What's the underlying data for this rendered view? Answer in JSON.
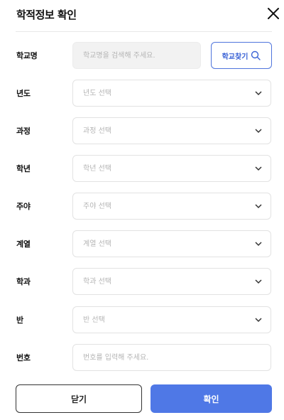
{
  "header": {
    "title": "학적정보 확인"
  },
  "school": {
    "label": "학교명",
    "placeholder": "학교명을 검색해 주세요.",
    "search_label": "학교찾기"
  },
  "fields": [
    {
      "label": "년도",
      "placeholder": "년도 선택"
    },
    {
      "label": "과정",
      "placeholder": "과정 선택"
    },
    {
      "label": "학년",
      "placeholder": "학년 선택"
    },
    {
      "label": "주야",
      "placeholder": "주야 선택"
    },
    {
      "label": "계열",
      "placeholder": "계열 선택"
    },
    {
      "label": "학과",
      "placeholder": "학과 선택"
    },
    {
      "label": "반",
      "placeholder": "반 선택"
    }
  ],
  "number": {
    "label": "번호",
    "placeholder": "번호를 입력해 주세요."
  },
  "footer": {
    "close_label": "닫기",
    "confirm_label": "확인"
  },
  "colors": {
    "accent": "#4f78e6",
    "outline_accent": "#4f74dc"
  }
}
